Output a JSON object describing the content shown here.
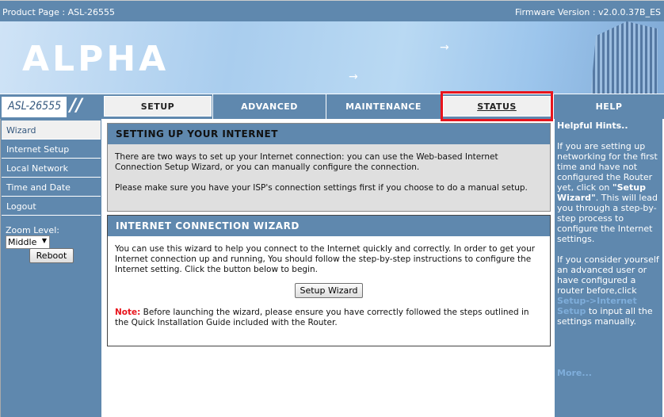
{
  "topbar": {
    "product": "Product Page : ASL-26555",
    "firmware": "Firmware Version :  v2.0.0.37B_ES"
  },
  "banner": {
    "logo": "ALPHA"
  },
  "nav": {
    "model": "ASL-26555",
    "tabs": [
      {
        "label": "SETUP",
        "active": true
      },
      {
        "label": "ADVANCED"
      },
      {
        "label": "MAINTENANCE"
      },
      {
        "label": "STATUS",
        "highlighted": true
      },
      {
        "label": "HELP"
      }
    ],
    "highlight_color": "#e8141c"
  },
  "sidebar": {
    "items": [
      {
        "label": "Wizard",
        "active": true
      },
      {
        "label": "Internet Setup"
      },
      {
        "label": "Local Network"
      },
      {
        "label": "Time and Date"
      },
      {
        "label": "Logout"
      }
    ],
    "zoom_label": "Zoom Level:",
    "zoom_value": "Middle",
    "reboot": "Reboot"
  },
  "main": {
    "setup": {
      "title": "SETTING UP YOUR INTERNET",
      "p1": "There are two ways to set up your Internet connection: you can use the Web-based Internet Connection Setup Wizard, or you can manually configure the connection.",
      "p2": "Please make sure you have your ISP's connection settings first if you choose to do a manual setup."
    },
    "wizard": {
      "title": "INTERNET CONNECTION WIZARD",
      "p1": "You can use this wizard to help you connect to the Internet quickly and correctly. In order to get your Internet connection up and running, You should follow the step-by-step instructions to configure the Internet setting. Click the button below to begin.",
      "button": "Setup Wizard",
      "note_label": "Note:",
      "note": " Before launching the wizard, please ensure you have correctly followed the steps outlined in the Quick Installation Guide included with the Router."
    }
  },
  "hints": {
    "title": "Helpful Hints..",
    "p1a": "If you are setting up networking for the first time and have not configured the Router yet, click on ",
    "p1b": "\"Setup Wizard\"",
    "p1c": ". This will lead you through a step-by-step process to configure the Internet settings.",
    "p2a": "If you consider yourself an advanced user or have configured a router before,click ",
    "p2link": "Setup->Internet Setup",
    "p2b": " to input all the settings manually.",
    "more": "More..."
  },
  "colors": {
    "theme": "#5f88ae"
  }
}
